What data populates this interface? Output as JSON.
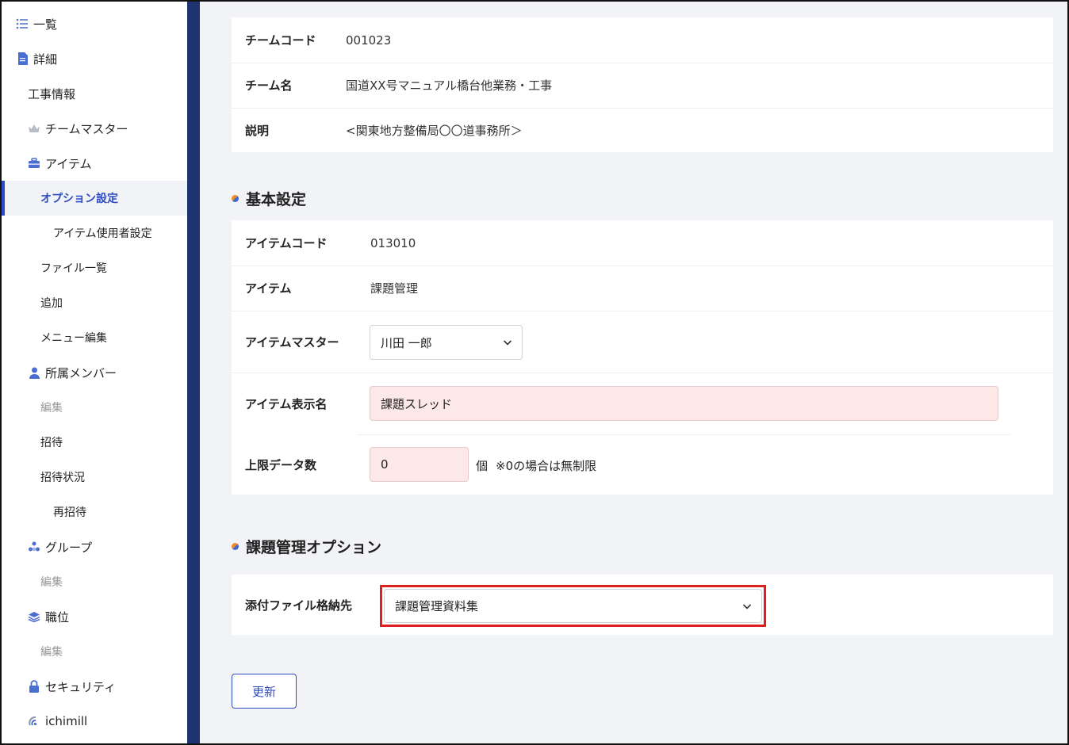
{
  "sidebar": {
    "items": [
      {
        "label": "一覧",
        "icon": "list-icon"
      },
      {
        "label": "詳細",
        "icon": "document-icon"
      },
      {
        "label": "工事情報"
      },
      {
        "label": "チームマスター",
        "icon": "crown-icon"
      },
      {
        "label": "アイテム",
        "icon": "toolbox-icon"
      },
      {
        "label": "オプション設定",
        "active": true
      },
      {
        "label": "アイテム使用者設定"
      },
      {
        "label": "ファイル一覧"
      },
      {
        "label": "追加"
      },
      {
        "label": "メニュー編集"
      },
      {
        "label": "所属メンバー",
        "icon": "person-icon"
      },
      {
        "label": "編集"
      },
      {
        "label": "招待"
      },
      {
        "label": "招待状況"
      },
      {
        "label": "再招待"
      },
      {
        "label": "グループ",
        "icon": "group-icon"
      },
      {
        "label": "編集"
      },
      {
        "label": "職位",
        "icon": "layers-icon"
      },
      {
        "label": "編集"
      },
      {
        "label": "セキュリティ",
        "icon": "lock-icon"
      },
      {
        "label": "ichimill",
        "icon": "ichimill-icon"
      }
    ]
  },
  "team_info": {
    "rows": [
      {
        "label": "チームコード",
        "value": "001023"
      },
      {
        "label": "チーム名",
        "value": "国道XX号マニュアル橋台他業務・工事"
      },
      {
        "label": "説明",
        "value": "<関東地方整備局〇〇道事務所＞"
      }
    ]
  },
  "basic": {
    "title": "基本設定",
    "item_code_label": "アイテムコード",
    "item_code": "013010",
    "item_label": "アイテム",
    "item_value": "課題管理",
    "master_label": "アイテムマスター",
    "master_value": "川田 一郎",
    "display_name_label": "アイテム表示名",
    "display_name_value": "課題スレッド",
    "limit_label": "上限データ数",
    "limit_value": "0",
    "limit_unit": "個",
    "limit_note": "※0の場合は無制限"
  },
  "option": {
    "title": "課題管理オプション",
    "attach_label": "添付ファイル格納先",
    "attach_value": "課題管理資料集"
  },
  "actions": {
    "update_label": "更新"
  },
  "colors": {
    "accent": "#2e4bc6",
    "band": "#1f3371",
    "highlight": "#e02020",
    "input_pink": "#fde8e8"
  }
}
